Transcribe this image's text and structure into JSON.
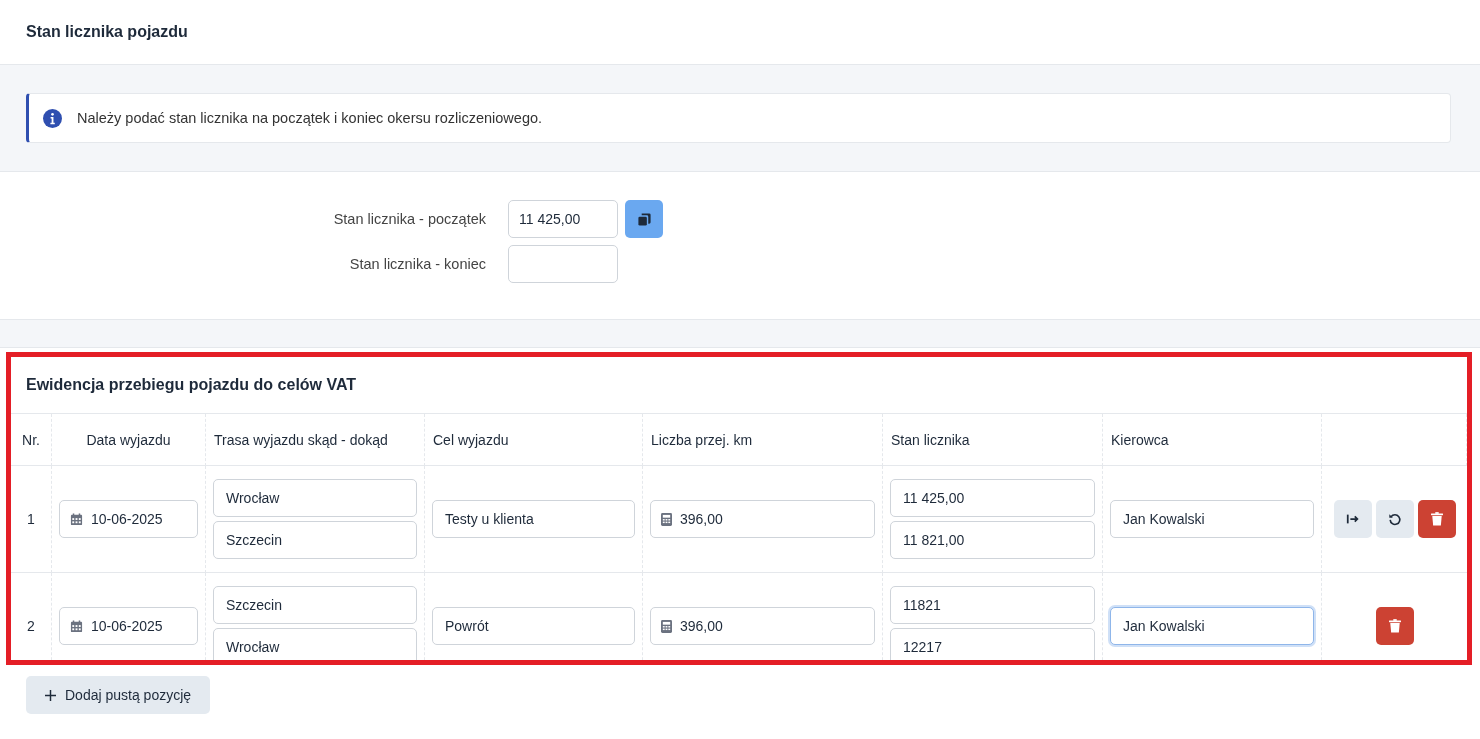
{
  "page_title": "Stan licznika pojazdu",
  "alert": {
    "text": "Należy podać stan licznika na początek i koniec okersu rozliczeniowego."
  },
  "odometer_form": [
    {
      "label": "Stan licznika - początek",
      "value": "11 425,00",
      "has_copy_button": true
    },
    {
      "label": "Stan licznika - koniec",
      "has_copy_button": false
    }
  ],
  "mileage_log": {
    "title": "Ewidencja przebiegu pojazdu do celów VAT",
    "columns": [
      "Nr.",
      "Data wyjazdu",
      "Trasa wyjazdu skąd - dokąd",
      "Cel wyjazdu",
      "Liczba przej. km",
      "Stan licznika",
      "Kierowca"
    ],
    "rows": [
      {
        "nr": "1",
        "date": "10-06-2025",
        "route_from": "Wrocław",
        "route_to": "Szczecin",
        "purpose": "Testy u klienta",
        "km": "396,00",
        "odometer_start": "11 425,00",
        "odometer_end": "11 821,00",
        "driver": "Jan Kowalski",
        "driver_focused": false,
        "actions": [
          {
            "kind": "transfer"
          },
          {
            "kind": "reset"
          },
          {
            "kind": "delete"
          }
        ]
      },
      {
        "nr": "2",
        "date": "10-06-2025",
        "route_from": "Szczecin",
        "route_to": "Wrocław",
        "purpose": "Powrót",
        "km": "396,00",
        "odometer_start": "11821",
        "odometer_end": "12217",
        "driver": "Jan Kowalski",
        "driver_focused": true,
        "actions": [
          {
            "kind": "delete"
          }
        ]
      }
    ]
  },
  "add_button": {
    "label": "Dodaj pustą pozycję"
  }
}
